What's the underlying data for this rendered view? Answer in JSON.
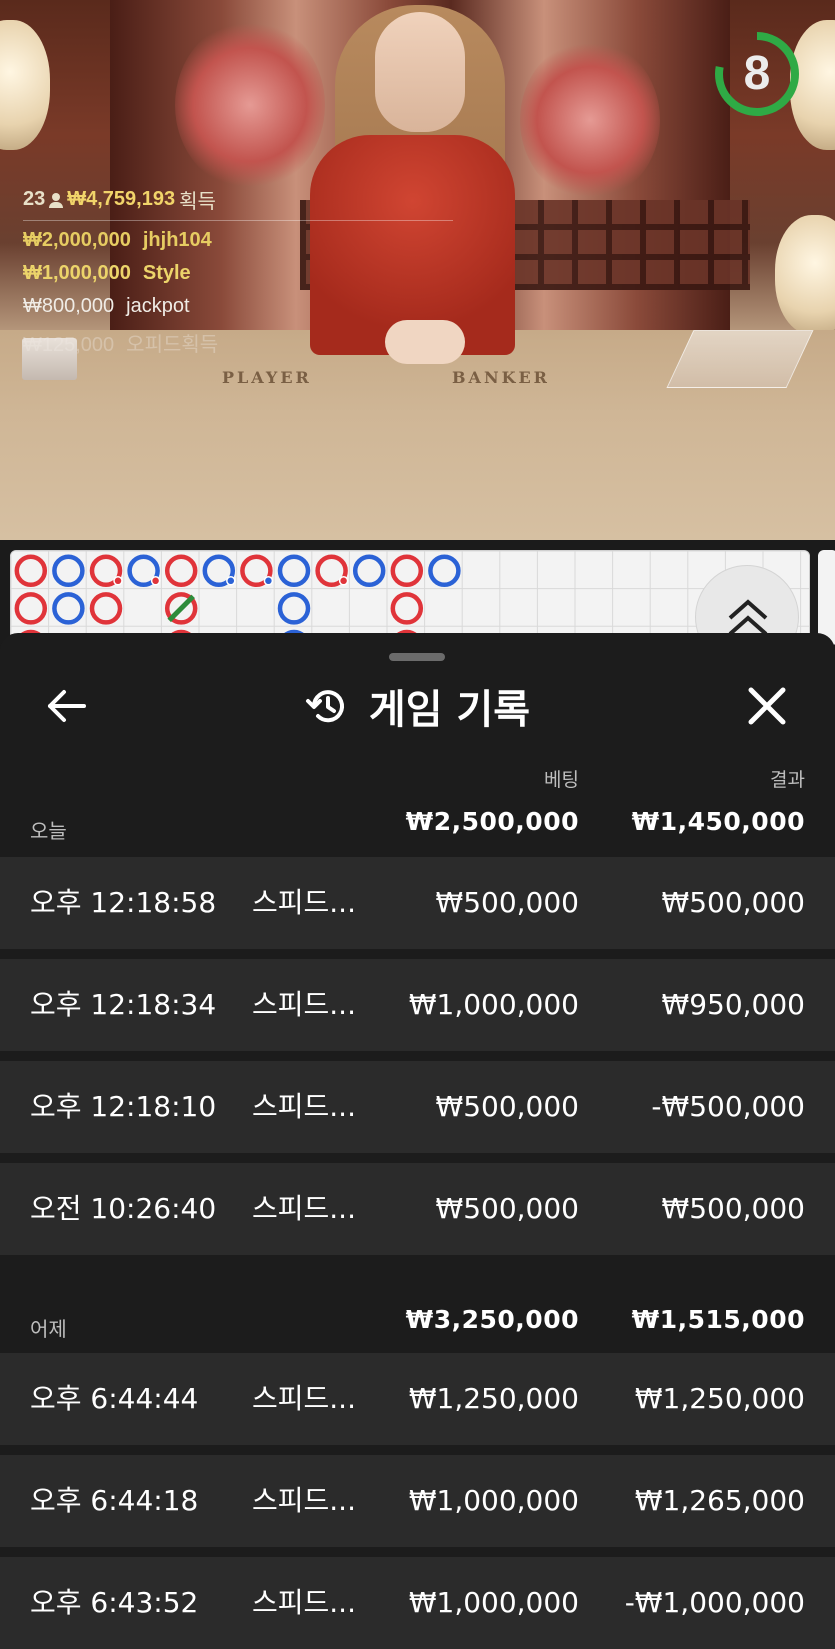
{
  "video": {
    "countdown": "8",
    "winners_total": {
      "count": "23",
      "amount": "₩4,759,193",
      "label": "획득"
    },
    "winners": [
      {
        "amount": "₩2,000,000",
        "name": "jhjh104"
      },
      {
        "amount": "₩1,000,000",
        "name": "Style"
      },
      {
        "amount": "₩800,000",
        "name": "jackpot"
      },
      {
        "amount": "₩125,000",
        "name": "오피드획득"
      }
    ],
    "table_labels": {
      "player": "PLAYER",
      "banker": "BANKER"
    }
  },
  "sheet": {
    "title": "게임 기록",
    "columns": {
      "bet": "베팅",
      "result": "결과"
    },
    "sections": [
      {
        "day": "오늘",
        "bet_total": "₩2,500,000",
        "result_total": "₩1,450,000",
        "rows": [
          {
            "time": "오후 12:18:58",
            "game": "스피드...",
            "bet": "₩500,000",
            "result": "₩500,000"
          },
          {
            "time": "오후 12:18:34",
            "game": "스피드...",
            "bet": "₩1,000,000",
            "result": "₩950,000"
          },
          {
            "time": "오후 12:18:10",
            "game": "스피드...",
            "bet": "₩500,000",
            "result": "-₩500,000"
          },
          {
            "time": "오전 10:26:40",
            "game": "스피드...",
            "bet": "₩500,000",
            "result": "₩500,000"
          }
        ]
      },
      {
        "day": "어제",
        "bet_total": "₩3,250,000",
        "result_total": "₩1,515,000",
        "rows": [
          {
            "time": "오후 6:44:44",
            "game": "스피드...",
            "bet": "₩1,250,000",
            "result": "₩1,250,000"
          },
          {
            "time": "오후 6:44:18",
            "game": "스피드...",
            "bet": "₩1,000,000",
            "result": "₩1,265,000"
          },
          {
            "time": "오후 6:43:52",
            "game": "스피드...",
            "bet": "₩1,000,000",
            "result": "-₩1,000,000"
          }
        ]
      }
    ]
  },
  "colors": {
    "banker": "#e0343a",
    "player": "#2b62d6",
    "tie": "#2e8b3a",
    "timer_ring": "#2faa45",
    "gold": "#e6cc62"
  },
  "icons": [
    "back-arrow-icon",
    "history-icon",
    "close-icon",
    "double-chevron-up-icon",
    "person-icon"
  ]
}
